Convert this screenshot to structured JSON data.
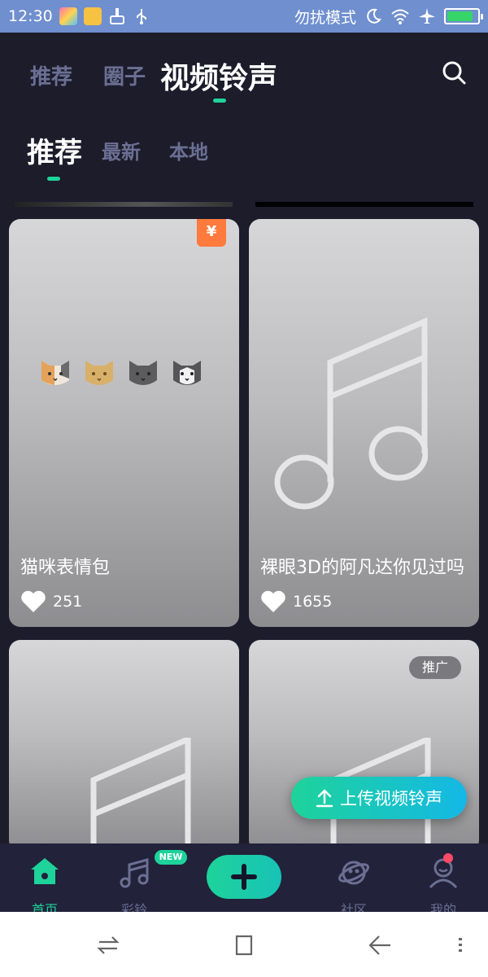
{
  "status_bar": {
    "time": "12:30",
    "mode": "勿扰模式",
    "battery_level": 0.85
  },
  "top_tabs": [
    {
      "label": "推荐",
      "active": false
    },
    {
      "label": "圈子",
      "active": false
    },
    {
      "label": "视频铃声",
      "active": true
    }
  ],
  "sub_tabs": [
    {
      "label": "推荐",
      "active": true
    },
    {
      "label": "最新",
      "active": false
    },
    {
      "label": "本地",
      "active": false
    }
  ],
  "cards": [
    {
      "title": "猫咪表情包",
      "likes": "251",
      "badge": "¥"
    },
    {
      "title": "裸眼3D的阿凡达你见过吗",
      "likes": "1655"
    },
    {},
    {
      "badge": "推广"
    }
  ],
  "upload_button": {
    "label": "上传视频铃声"
  },
  "bottom_nav": {
    "home": "首页",
    "ringtone": "彩铃",
    "new_badge": "NEW",
    "community": "社区",
    "mine": "我的"
  },
  "colors": {
    "accent": "#1ed39a",
    "background": "#1c1c2b",
    "inactive": "#6b6f93",
    "status_bar": "#6f8fcf"
  }
}
